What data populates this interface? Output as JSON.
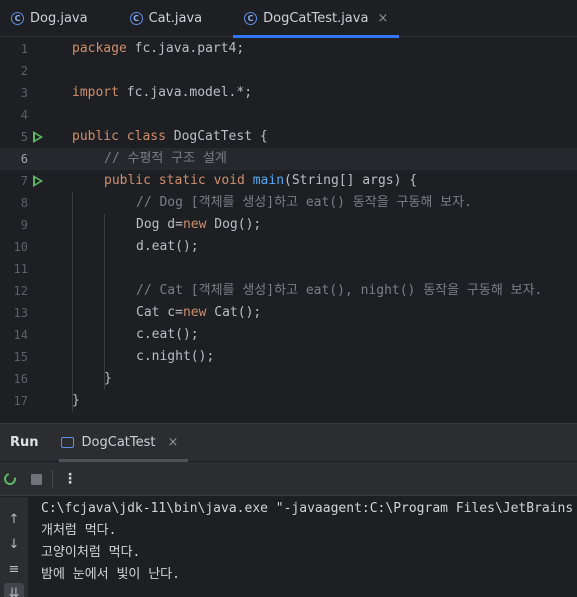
{
  "tabs": [
    {
      "label": "Dog.java",
      "icon": "class-icon",
      "active": false
    },
    {
      "label": "Cat.java",
      "icon": "class-icon",
      "active": false
    },
    {
      "label": "DogCatTest.java",
      "icon": "class-icon",
      "active": true,
      "close": "×"
    }
  ],
  "editor": {
    "line_numbers": [
      "1",
      "2",
      "3",
      "4",
      "5",
      "6",
      "7",
      "8",
      "9",
      "10",
      "11",
      "12",
      "13",
      "14",
      "15",
      "16",
      "17"
    ],
    "current_line": "6",
    "code": {
      "l1_kw": "package",
      "l1_rest": " fc.java.part4;",
      "l3_kw": "import",
      "l3_rest": " fc.java.model.*;",
      "l5_kw": "public class",
      "l5_rest": " DogCatTest {",
      "l6_cm": "// 수평적 구조 설계",
      "l7_kw": "public static void",
      "l7_fn": "main",
      "l7_rest": "(String[] args) {",
      "l8_cm": "// Dog [객체를 생성]하고 eat() 동작을 구동해 보자.",
      "l9_a": "Dog d=",
      "l9_kw": "new",
      "l9_b": " Dog();",
      "l10": "d.eat();",
      "l12_cm": "// Cat [객체를 생성]하고 eat(), night() 동작을 구동해 보자.",
      "l13_a": "Cat c=",
      "l13_kw": "new",
      "l13_b": " Cat();",
      "l14": "c.eat();",
      "l15": "c.night();",
      "l16": "}",
      "l17": "}"
    }
  },
  "run_panel": {
    "title": "Run",
    "tab_label": "DogCatTest",
    "tab_close": "×",
    "more": "⋮",
    "side_icons": [
      "up-arrow-icon",
      "down-arrow-icon",
      "soft-wrap-icon",
      "scroll-to-end-icon"
    ],
    "output": [
      "C:\\fcjava\\jdk-11\\bin\\java.exe \"-javaagent:C:\\Program Files\\JetBrains",
      "개처럼 먹다.",
      "고양이처럼 먹다.",
      "밤에 눈에서 빛이 난다."
    ]
  },
  "colors": {
    "background": "#1e1f22",
    "panel": "#2b2d30",
    "keyword": "#cf8e6d",
    "function": "#56a8f5",
    "comment": "#7a7e85",
    "accent": "#3574f0",
    "run_green": "#5fb865"
  }
}
